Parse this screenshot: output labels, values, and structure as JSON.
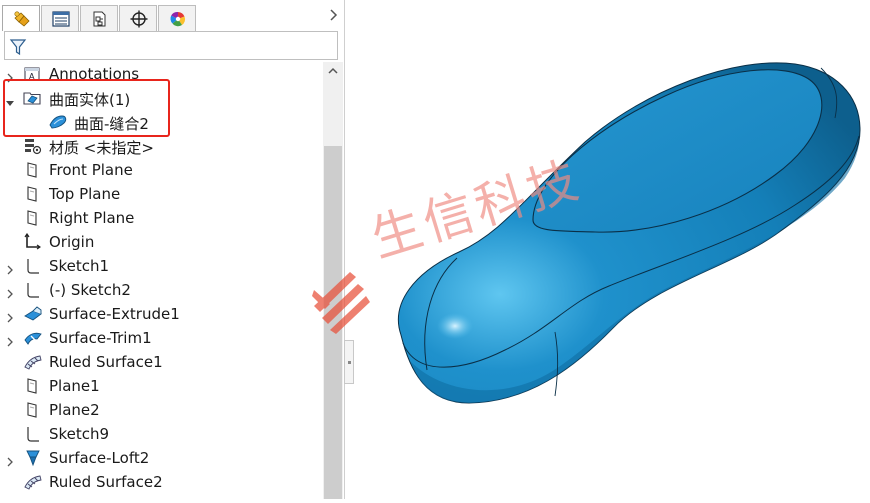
{
  "tabs": [
    {
      "name": "feature-manager",
      "icon": "feature-tree-icon"
    },
    {
      "name": "property-manager",
      "icon": "property-list-icon"
    },
    {
      "name": "configuration-manager",
      "icon": "configuration-icon"
    },
    {
      "name": "dimxpert-manager",
      "icon": "crosshair-icon"
    },
    {
      "name": "display-manager",
      "icon": "color-wheel-icon"
    }
  ],
  "tree": [
    {
      "label": "Annotations",
      "icon": "annotations-icon",
      "expander": true,
      "indent": 0
    },
    {
      "label": "曲面实体(1)",
      "icon": "surface-bodies-folder-icon",
      "expander": true,
      "expanded": true,
      "indent": 0
    },
    {
      "label": "曲面-缝合2",
      "icon": "knit-surface-icon",
      "expander": false,
      "indent": 1
    },
    {
      "label": "材质 <未指定>",
      "icon": "material-icon",
      "expander": false,
      "indent": 0
    },
    {
      "label": "Front Plane",
      "icon": "plane-icon",
      "expander": false,
      "indent": 0
    },
    {
      "label": "Top Plane",
      "icon": "plane-icon",
      "expander": false,
      "indent": 0
    },
    {
      "label": "Right Plane",
      "icon": "plane-icon",
      "expander": false,
      "indent": 0
    },
    {
      "label": "Origin",
      "icon": "origin-icon",
      "expander": false,
      "indent": 0
    },
    {
      "label": "Sketch1",
      "icon": "sketch-icon",
      "expander": true,
      "indent": 0
    },
    {
      "label": "(-) Sketch2",
      "icon": "sketch-icon",
      "expander": true,
      "indent": 0
    },
    {
      "label": "Surface-Extrude1",
      "icon": "surface-extrude-icon",
      "expander": true,
      "indent": 0
    },
    {
      "label": "Surface-Trim1",
      "icon": "surface-trim-icon",
      "expander": true,
      "indent": 0
    },
    {
      "label": "Ruled Surface1",
      "icon": "ruled-surface-icon",
      "expander": false,
      "indent": 0
    },
    {
      "label": "Plane1",
      "icon": "plane-icon",
      "expander": false,
      "indent": 0
    },
    {
      "label": "Plane2",
      "icon": "plane-icon",
      "expander": false,
      "indent": 0
    },
    {
      "label": "Sketch9",
      "icon": "sketch-icon",
      "expander": false,
      "indent": 0
    },
    {
      "label": "Surface-Loft2",
      "icon": "surface-loft-icon",
      "expander": true,
      "indent": 0
    },
    {
      "label": "Ruled Surface2",
      "icon": "ruled-surface-icon",
      "expander": false,
      "indent": 0
    }
  ],
  "watermark": {
    "text": "生信科技",
    "color": "#e8503a"
  },
  "highlight_color": "#e8251c",
  "model_color": "#1c86c0"
}
